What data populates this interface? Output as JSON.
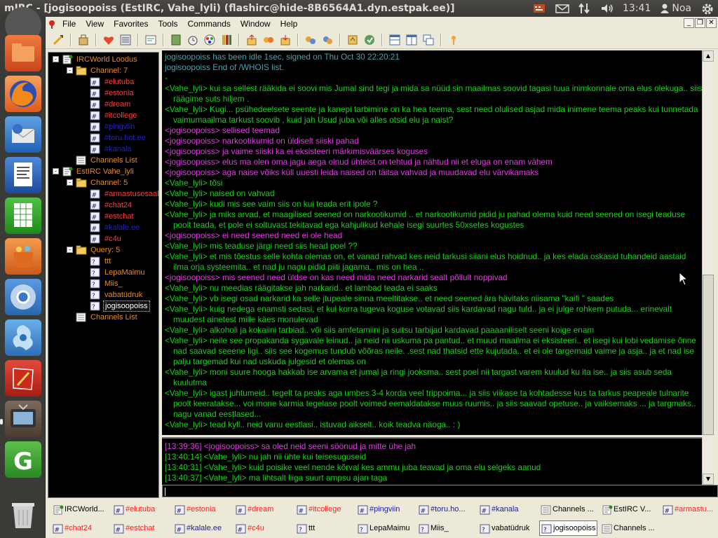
{
  "window": {
    "title": "mIRC - [jogisoopoiss (EstIRC, Vahe_lyli) (flashirc@hide-8B6564A1.dyn.estpak.ee)]"
  },
  "top_panel": {
    "clock": "13:41",
    "user": "Noa",
    "icons": [
      "keyboard-icon",
      "mail-icon",
      "network-icon",
      "volume-icon",
      "user-icon",
      "gear-icon"
    ]
  },
  "launcher": {
    "items": [
      "dash-icon",
      "files-icon",
      "firefox-icon",
      "thunderbird-icon",
      "writer-icon",
      "calc-icon",
      "software-center-icon",
      "chromium-icon",
      "tweak-icon",
      "reader-icon",
      "tv-icon",
      "gedit-icon",
      "trash-icon"
    ]
  },
  "menu": {
    "items": [
      "File",
      "View",
      "Favorites",
      "Tools",
      "Commands",
      "Window",
      "Help"
    ]
  },
  "colors": {
    "chat_bg": "#000000",
    "nick_green": "#18d017",
    "self_magenta": "#e03be0",
    "whois_gray": "#4ea0a8",
    "channel_red": "#ff3b3b",
    "tree_blue": "#3a3adf",
    "tree_orange": "#e58a19"
  },
  "tree": {
    "rows": [
      {
        "text": "IRCWorld Loodus",
        "color": "#e58a19",
        "indent": 0,
        "toggle": "-",
        "icon": "server-icon"
      },
      {
        "text": "Channel: 7",
        "color": "#e58a19",
        "indent": 1,
        "toggle": "-",
        "icon": "folder-icon"
      },
      {
        "text": "#elutuba",
        "color": "#ff3b3b",
        "indent": 2,
        "toggle": "",
        "icon": "channel-icon"
      },
      {
        "text": "#estonia",
        "color": "#ff3b3b",
        "indent": 2,
        "toggle": "",
        "icon": "channel-icon"
      },
      {
        "text": "#dream",
        "color": "#ff3b3b",
        "indent": 2,
        "toggle": "",
        "icon": "channel-icon"
      },
      {
        "text": "#itcollege",
        "color": "#ff3b3b",
        "indent": 2,
        "toggle": "",
        "icon": "channel-icon"
      },
      {
        "text": "#pingviin",
        "color": "#2323b8",
        "indent": 2,
        "toggle": "",
        "icon": "channel-icon"
      },
      {
        "text": "#toru.hot.ee",
        "color": "#2323b8",
        "indent": 2,
        "toggle": "",
        "icon": "channel-icon"
      },
      {
        "text": "#kanala",
        "color": "#2323b8",
        "indent": 2,
        "toggle": "",
        "icon": "channel-icon"
      },
      {
        "text": "Channels List",
        "color": "#e58a19",
        "indent": 1,
        "toggle": "",
        "icon": "list-icon"
      },
      {
        "text": "EstIRC Vahe_lyli",
        "color": "#e58a19",
        "indent": 0,
        "toggle": "-",
        "icon": "server-icon"
      },
      {
        "text": "Channel: 5",
        "color": "#e58a19",
        "indent": 1,
        "toggle": "-",
        "icon": "folder-icon"
      },
      {
        "text": "#armastusesaal",
        "color": "#ff3b3b",
        "indent": 2,
        "toggle": "",
        "icon": "channel-icon"
      },
      {
        "text": "#chat24",
        "color": "#ff3b3b",
        "indent": 2,
        "toggle": "",
        "icon": "channel-icon"
      },
      {
        "text": "#estchat",
        "color": "#ff3b3b",
        "indent": 2,
        "toggle": "",
        "icon": "channel-icon"
      },
      {
        "text": "#kalale.ee",
        "color": "#2323b8",
        "indent": 2,
        "toggle": "",
        "icon": "channel-icon"
      },
      {
        "text": "#c4u",
        "color": "#ff3b3b",
        "indent": 2,
        "toggle": "",
        "icon": "channel-icon"
      },
      {
        "text": "Query: 5",
        "color": "#e58a19",
        "indent": 1,
        "toggle": "-",
        "icon": "folder-icon"
      },
      {
        "text": "ttt",
        "color": "#e58a19",
        "indent": 2,
        "toggle": "",
        "icon": "query-icon"
      },
      {
        "text": "LepaMaimu",
        "color": "#e58a19",
        "indent": 2,
        "toggle": "",
        "icon": "query-icon"
      },
      {
        "text": "Miis_",
        "color": "#e58a19",
        "indent": 2,
        "toggle": "",
        "icon": "query-icon"
      },
      {
        "text": "vabatüdruk",
        "color": "#e58a19",
        "indent": 2,
        "toggle": "",
        "icon": "query-icon"
      },
      {
        "text": "jogisoopoiss",
        "color": "#ffffff",
        "indent": 2,
        "toggle": "",
        "icon": "query-icon",
        "selected": true
      },
      {
        "text": "Channels List",
        "color": "#e58a19",
        "indent": 1,
        "toggle": "",
        "icon": "list-icon"
      }
    ]
  },
  "chat": {
    "lines": [
      {
        "text": "jogisoopoiss has been idle 1sec, signed on Thu Oct 30 22:20:21",
        "color": "#4ea0a8"
      },
      {
        "text": "jogisoopoiss End of /WHOIS list.",
        "color": "#4ea0a8"
      },
      {
        "text": "-",
        "color": "#18d017"
      },
      {
        "text": "<Vahe_lyli> kui sa sellest rääkida ei soovi mis Jumal sind tegi ja mida sa nüüd sin maailmas soovid tagasi tuua inimkonnale oma elus olekuga.. siis räägime suts hiljem .",
        "color": "#18d017"
      },
      {
        "text": "<Vahe_lyli> Kugi... psühedeelsete seente ja kanepi tarbimine on ka hea teema, sest need olulised asjad mida inimene teema peaks kui tunnetada vaimumaailma tarkust soovib , kuid jah Usud juba või alles otsid elu ja naist?",
        "color": "#18d017"
      },
      {
        "text": "<jogisoopoiss> sellised teemad",
        "color": "#e03be0"
      },
      {
        "text": "<jogisoopoiss> narkootikumid on üldiselt siiski pahad",
        "color": "#e03be0"
      },
      {
        "text": "<jogisoopoiss> ja vaime siiski ka ei eksisteeri märkimisväärses koguses",
        "color": "#e03be0"
      },
      {
        "text": "<jogisoopoiss> elus ma olen oma jagu aega olnud ühteist on tehtud ja nähtud nii et eluga on enam vähem",
        "color": "#e03be0"
      },
      {
        "text": "<jogisoopoiss> aga naise võiks küll uuesti leida naised on täitsa vahvad ja muudavad elu värvikamaks",
        "color": "#e03be0"
      },
      {
        "text": "<Vahe_lyli> tõsi",
        "color": "#18d017"
      },
      {
        "text": "<Vahe_lyli> naised on vahvad",
        "color": "#18d017"
      },
      {
        "text": "<Vahe_lyli> kudi mis see vaim siis on kui teada erit ipole ?",
        "color": "#18d017"
      },
      {
        "text": "<Vahe_lyli> ja miks arvad, et maagilised seened on narkootikumid .. et narkootikumid pidid ju pahad olema kuid need seened on isegi teaduse poolt teada, et pole ei soltuvast tekitavad ega kahjulikud kehale isegi suurtes 50xsetes kogustes",
        "color": "#18d017"
      },
      {
        "text": "<jogisoopoiss> ei need seened need ei ole head",
        "color": "#e03be0"
      },
      {
        "text": "<Vahe_lyli> mis teaduse järgi need siis head poel ??",
        "color": "#18d017"
      },
      {
        "text": "<Vahe_lyli> et mis tõestus selle kohta olemas on, et vanad rahvad kes neid tarkusi siiani elus hoidnud.. ja kes elada oskasid tuhandeid aastaid ilma orja systeemita.. et nad ju nagu pidid piiti jagama.. mis on hea ..",
        "color": "#18d017"
      },
      {
        "text": "<jogisoopoiss> mis seened need üldse on kas need mida need narkarid sealt põllult noppivad",
        "color": "#e03be0"
      },
      {
        "text": "<Vahe_lyli> nu meedias räägitakse jah narkarid.. et lambad teada ei saaks",
        "color": "#18d017"
      },
      {
        "text": "<Vahe_lyli> vb isegi osad narkarid ka selle jtupeale sinna meeltitakse.. et need seened ära hävitaks niisama \"kaifi \" saades",
        "color": "#18d017"
      },
      {
        "text": "<Vahe_lyli> kuig nedega enamsti sedasi, et kui korra tugeva koguse votavad siis kardavad nagu tuld.. ja ei julge rohkem putuda... erinevalt muudest ainetest mille käes monulevad",
        "color": "#18d017"
      },
      {
        "text": "<Vahe_lyli> alkoholi ja kokaiini tarbiad.. või siis amfetamiini ja suitsu tarbijad kardavad paaaaniliselt seeni koige enam",
        "color": "#18d017"
      },
      {
        "text": "<Vahe_lyli> neile see propakanda sygavale leinud.. ja neid nii uskuma pa pantud.. et muud maailma ei eksisteeri.. et isegi kui lobi vedamise õnne nad saavad seeene ligi.. siis see kogemus tundub võõras neile. .sest nad thatsid ette kujutada.. et ei ole targemaid vaime ja asja.. ja et nad ise palju targemad kui nad uskuda julgesid et olemas on",
        "color": "#18d017"
      },
      {
        "text": "<Vahe_lyli> moni suure hooga hakkab ise arvama et jumal ja ringi jooksma.. sest poel nii targast varem kuulud ku ita ise.. ja siis asub seda kuulutma",
        "color": "#18d017"
      },
      {
        "text": "<Vahe_lyli> igast juhtumeid.. tegelt ta peaks aga umbes 3-4 korda veel trippoima... ja siis viikase ta kohtadesse kus ta tarkus peapeale tulnarite poolt keeratakse... voi mone karmia tegelase poolt voimed eemaldatakse muus ruumis.. ja siis saavad opetuse.. ja vaiksemaks ... ja targmaks.. nagu vanad eestlased...",
        "color": "#18d017"
      },
      {
        "text": "<Vahe_lyli> tead kyll.. neid vanu eestlasi.. istuvad aikselt.. koik teadva näoga.. : )",
        "color": "#18d017"
      }
    ]
  },
  "recent": {
    "lines": [
      {
        "text": "[13:39:36] <jogisoopoiss> sa oled neid seeni söönud ja mitte ühe jah",
        "color": "#e03be0"
      },
      {
        "text": "[13:40:14] <Vahe_lyli> nu jah nii  ühte kui teisesuguseid",
        "color": "#18d017"
      },
      {
        "text": "[13:40:31] <Vahe_lyli> kuid poisike veel nende kõrval kes ammu juba teavad ja oma elu selgeks aanud",
        "color": "#18d017"
      },
      {
        "text": "[13:40:37] <Vahe_lyli> ma lihtsalt liiga suurt ampsu ajan taga",
        "color": "#18d017"
      }
    ]
  },
  "switchbar": {
    "row1": [
      {
        "text": "IRCWorld...",
        "color": "#000000",
        "icon": "server-icon"
      },
      {
        "text": "#elutuba",
        "color": "#ff2020",
        "icon": "channel-icon"
      },
      {
        "text": "#estonia",
        "color": "#ff2020",
        "icon": "channel-icon"
      },
      {
        "text": "#dream",
        "color": "#ff2020",
        "icon": "channel-icon"
      },
      {
        "text": "#itcollege",
        "color": "#ff2020",
        "icon": "channel-icon"
      },
      {
        "text": "#pingviin",
        "color": "#1c1c9c",
        "icon": "channel-icon"
      },
      {
        "text": "#toru.ho...",
        "color": "#1c1c9c",
        "icon": "channel-icon"
      },
      {
        "text": "#kanala",
        "color": "#1c1c9c",
        "icon": "channel-icon"
      },
      {
        "text": "Channels ...",
        "color": "#000000",
        "icon": "list-icon"
      },
      {
        "text": "EstIRC V...",
        "color": "#000000",
        "icon": "server-icon"
      },
      {
        "text": "#armastu...",
        "color": "#ff2020",
        "icon": "channel-icon"
      }
    ],
    "row2": [
      {
        "text": "#chat24",
        "color": "#ff2020",
        "icon": "channel-icon"
      },
      {
        "text": "#estchat",
        "color": "#ff2020",
        "icon": "channel-icon"
      },
      {
        "text": "#kalale.ee",
        "color": "#1c1c9c",
        "icon": "channel-icon"
      },
      {
        "text": "#c4u",
        "color": "#ff2020",
        "icon": "channel-icon"
      },
      {
        "text": "ttt",
        "color": "#000000",
        "icon": "query-icon"
      },
      {
        "text": "LepaMaimu",
        "color": "#000000",
        "icon": "query-icon"
      },
      {
        "text": "Miis_",
        "color": "#000000",
        "icon": "query-icon"
      },
      {
        "text": "vabatüdruk",
        "color": "#000000",
        "icon": "query-icon"
      },
      {
        "text": "jogisoopoiss",
        "color": "#000000",
        "icon": "query-icon",
        "active": true
      },
      {
        "text": "Channels ...",
        "color": "#000000",
        "icon": "list-icon"
      }
    ]
  }
}
